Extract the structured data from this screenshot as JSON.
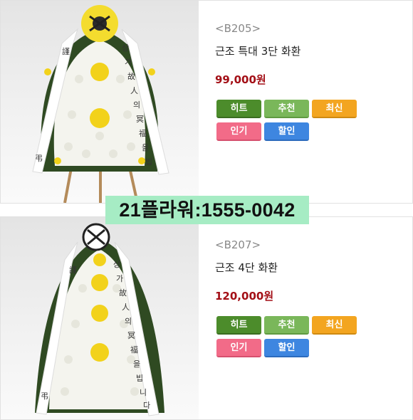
{
  "products": [
    {
      "code": "<B205>",
      "name": "근조 특대 3단 화환",
      "price": "99,000원",
      "image_desc": "funeral-wreath-3tier"
    },
    {
      "code": "<B207>",
      "name": "근조 4단 화환",
      "price": "120,000원",
      "image_desc": "funeral-wreath-4tier"
    }
  ],
  "badges": {
    "hit": "히트",
    "recommend": "추천",
    "new": "최신",
    "popular": "인기",
    "sale": "할인"
  },
  "phone_banner": "21플라워:1555-0042",
  "colors": {
    "price": "#a30f16",
    "hit": "#4c8c2b",
    "recommend": "#7ab75a",
    "new": "#f3a520",
    "popular": "#f26b88",
    "sale": "#3e86e0",
    "banner": "#a6ecc4"
  }
}
